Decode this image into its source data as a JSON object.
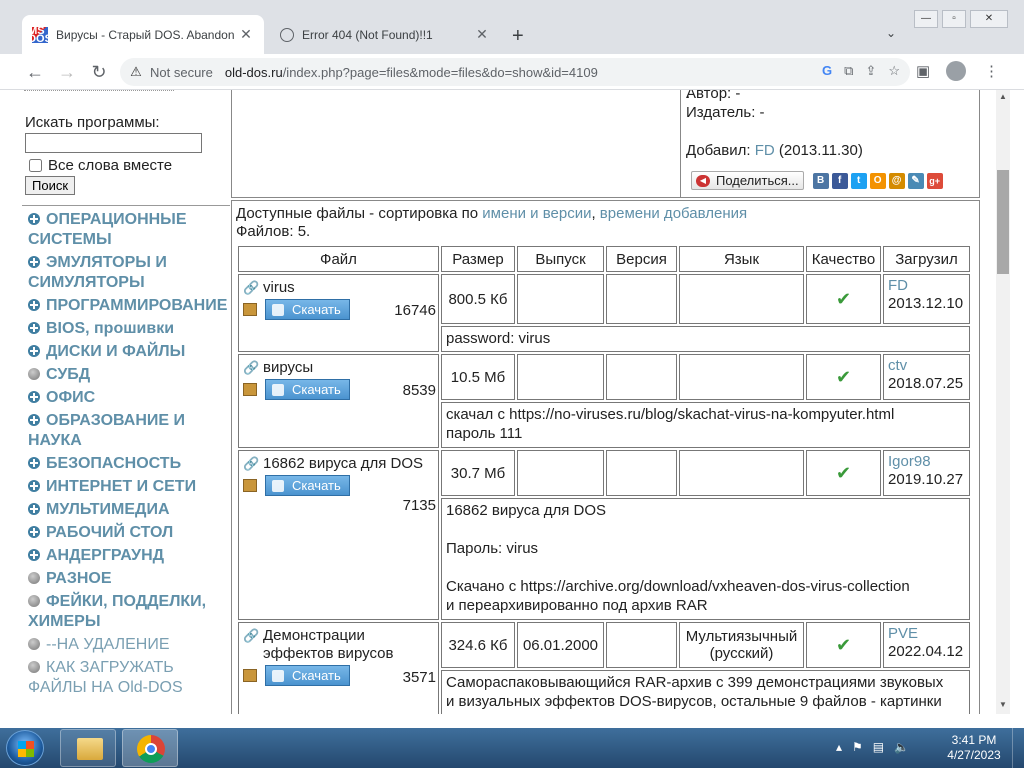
{
  "browser": {
    "tabs": [
      {
        "title": "Вирусы - Старый DOS. Abandon",
        "favicon": "msdos-icon",
        "active": true
      },
      {
        "title": "Error 404 (Not Found)!!1",
        "favicon": "globe-icon",
        "active": false
      }
    ],
    "new_tab": "+",
    "not_secure": "Not secure",
    "url_host": "old-dos.ru",
    "url_path": "/index.php?page=files&mode=files&do=show&id=4109"
  },
  "sidebar": {
    "search_label": "Искать программы:",
    "search_value": "",
    "all_words_label": "Все слова вместе",
    "search_button": "Поиск",
    "categories": [
      {
        "label": "ОПЕРАЦИОННЫЕ СИСТЕМЫ",
        "marker": "plus"
      },
      {
        "label": "ЭМУЛЯТОРЫ И СИМУЛЯТОРЫ",
        "marker": "plus"
      },
      {
        "label": "ПРОГРАММИРОВАНИЕ",
        "marker": "plus"
      },
      {
        "label": "BIOS, прошивки",
        "marker": "plus"
      },
      {
        "label": "ДИСКИ И ФАЙЛЫ",
        "marker": "plus"
      },
      {
        "label": "СУБД",
        "marker": "dot"
      },
      {
        "label": "ОФИС",
        "marker": "plus"
      },
      {
        "label": "ОБРАЗОВАНИЕ И НАУКА",
        "marker": "plus"
      },
      {
        "label": "БЕЗОПАСНОСТЬ",
        "marker": "plus"
      },
      {
        "label": "ИНТЕРНЕТ И СЕТИ",
        "marker": "plus"
      },
      {
        "label": "МУЛЬТИМЕДИА",
        "marker": "plus"
      },
      {
        "label": "РАБОЧИЙ СТОЛ",
        "marker": "plus"
      },
      {
        "label": "АНДЕРГРАУНД",
        "marker": "plus"
      },
      {
        "label": "РАЗНОЕ",
        "marker": "dot"
      },
      {
        "label": "ФЕЙКИ, ПОДДЕЛКИ, ХИМЕРЫ",
        "marker": "dot"
      },
      {
        "label": "--НА УДАЛЕНИЕ",
        "marker": "dot"
      },
      {
        "label": "КАК ЗАГРУЖАТЬ ФАЙЛЫ НА Old-DOS",
        "marker": "dot"
      }
    ]
  },
  "meta": {
    "author_label": "Автор: -",
    "publisher_label": "Издатель: -",
    "added_label": "Добавил:",
    "added_by": "FD",
    "added_date": "(2013.11.30)",
    "share_button": "Поделиться...",
    "social": [
      "В",
      "f",
      "t",
      "О",
      "@",
      "✎",
      "g+"
    ]
  },
  "files": {
    "header_text": "Доступные файлы - сортировка по",
    "sort_name": "имени и версии",
    "sort_date": "времени добавления",
    "count_text": "Файлов: 5.",
    "columns": [
      "Файл",
      "Размер",
      "Выпуск",
      "Версия",
      "Язык",
      "Качество",
      "Загрузил"
    ],
    "download_label": "Скачать",
    "rows": [
      {
        "name": "virus",
        "count": "16746",
        "size": "800.5 Кб",
        "release": "",
        "version": "",
        "lang": "",
        "quality": "✔",
        "uploader": "FD",
        "date": "2013.12.10",
        "desc": [
          "password: virus"
        ]
      },
      {
        "name": "вирусы",
        "count": "8539",
        "size": "10.5 Мб",
        "release": "",
        "version": "",
        "lang": "",
        "quality": "✔",
        "uploader": "ctv",
        "date": "2018.07.25",
        "desc": [
          "скачал с https://no-viruses.ru/blog/skachat-virus-na-kompyuter.html",
          "пароль 111"
        ]
      },
      {
        "name": "16862 вируса для DOS",
        "count": "7135",
        "size": "30.7 Мб",
        "release": "",
        "version": "",
        "lang": "",
        "quality": "✔",
        "uploader": "Igor98",
        "date": "2019.10.27",
        "desc": [
          "16862 вируса для DOS",
          "",
          "Пароль: virus",
          "",
          "Скачано с https://archive.org/download/vxheaven-dos-virus-collection",
          "и переархивированно под архив RAR"
        ]
      },
      {
        "name": "Демонстрации эффектов вирусов",
        "count": "3571",
        "size": "324.6 Кб",
        "release": "06.01.2000",
        "version": "",
        "lang": "Мультиязычный (русский)",
        "quality": "✔",
        "uploader": "PVE",
        "date": "2022.04.12",
        "desc": [
          "Самораспаковывающийся RAR-архив с 399 демонстрациями звуковых",
          "и визуальных эффектов DOS-вирусов, остальные 9 файлов - картинки"
        ]
      }
    ]
  },
  "taskbar": {
    "time": "3:41 PM",
    "date": "4/27/2023"
  }
}
